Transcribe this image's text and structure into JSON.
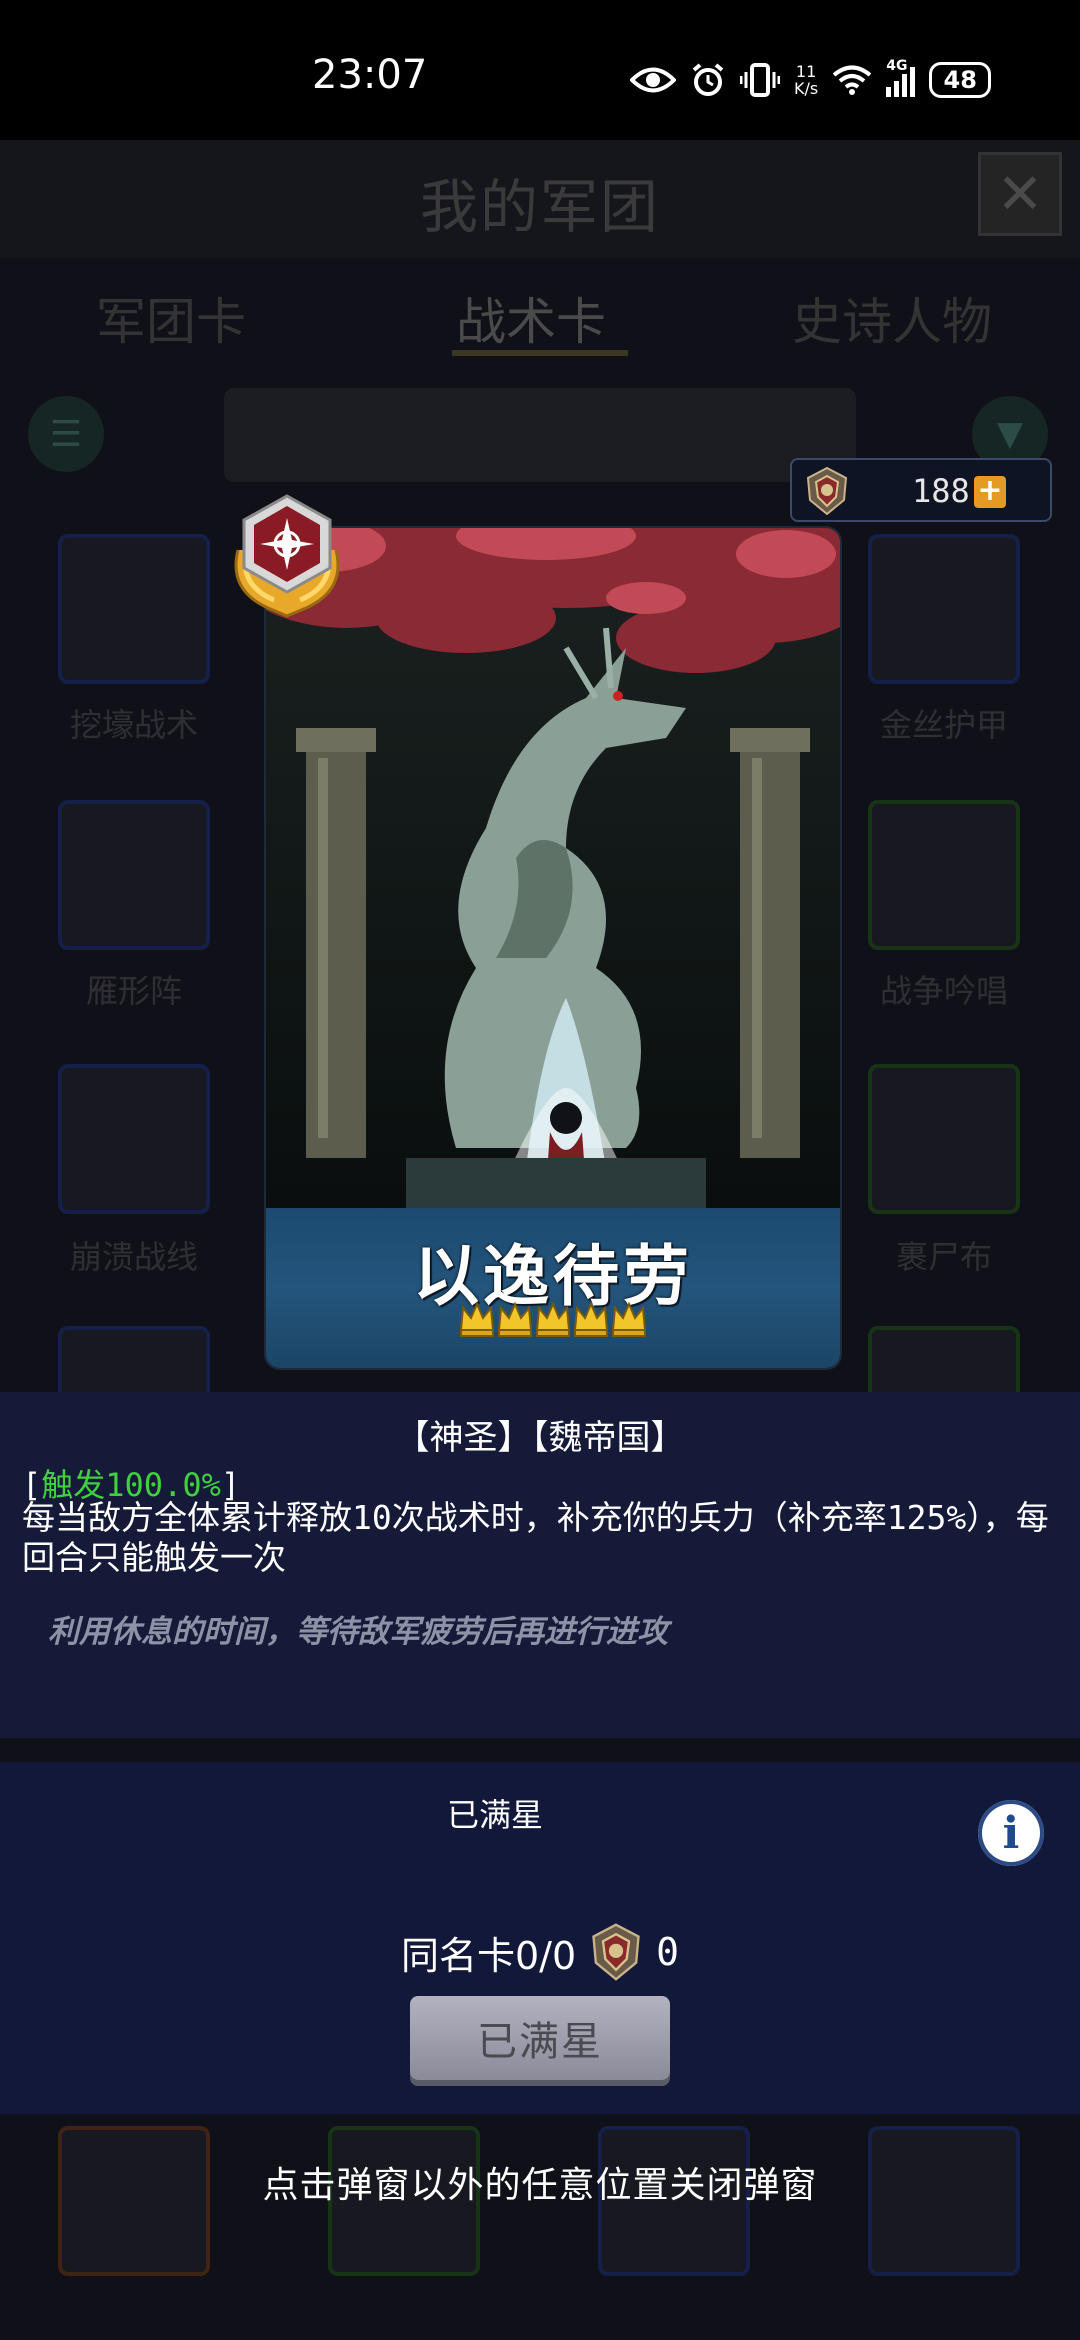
{
  "status_bar": {
    "time": "23:07",
    "net_speed_value": "11",
    "net_speed_unit": "K/s",
    "signal_label": "4G",
    "battery": "48",
    "icons": [
      "eye-icon",
      "alarm-icon",
      "vibrate-icon",
      "wifi-icon",
      "signal-icon",
      "battery-icon"
    ]
  },
  "background_page": {
    "title": "我的军团",
    "tabs": [
      "军团卡",
      "战术卡",
      "史诗人物"
    ],
    "active_tab": "战术卡",
    "left_cards": [
      "挖壕战术",
      "雁形阵",
      "崩溃战线"
    ],
    "right_cards": [
      "金丝护甲",
      "战争吟唱",
      "裹尸布"
    ]
  },
  "currency": {
    "value": "188"
  },
  "card": {
    "name": "以逸待劳",
    "stars": 5
  },
  "info": {
    "tags": "【神圣】【魏帝国】",
    "trigger_open": "[",
    "trigger_label": "触发100.0%",
    "trigger_close": "]",
    "effect": "每当敌方全体累计释放10次战术时，补充你的兵力（补充率125%），每回合只能触发一次",
    "flavor": "利用休息的时间，等待敌军疲劳后再进行进攻"
  },
  "upgrade": {
    "max_star_text": "已满星",
    "same_name_label": "同名卡0/0",
    "same_name_count": "0",
    "button_label": "已满星"
  },
  "close_hint": "点击弹窗以外的任意位置关闭弹窗",
  "colors": {
    "trigger_green": "#3fcf3f",
    "panel_blue": "#141a37",
    "card_banner": "#24557c",
    "crown_gold": "#f2c62a",
    "currency_plus": "#e59a24"
  }
}
